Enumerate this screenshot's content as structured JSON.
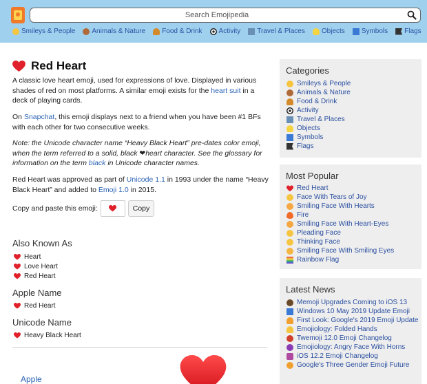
{
  "search": {
    "placeholder": "Search Emojipedia"
  },
  "nav": [
    {
      "label": "Smileys & People",
      "icon": "smiley-icon",
      "color": "#f5c542"
    },
    {
      "label": "Animals & Nature",
      "icon": "bear-icon",
      "color": "#b06a3a"
    },
    {
      "label": "Food & Drink",
      "icon": "burger-icon",
      "color": "#d48a2b"
    },
    {
      "label": "Activity",
      "icon": "soccer-ball-icon",
      "color": "#222222"
    },
    {
      "label": "Travel & Places",
      "icon": "buildings-icon",
      "color": "#6a8fb5"
    },
    {
      "label": "Objects",
      "icon": "lightbulb-icon",
      "color": "#f5d442"
    },
    {
      "label": "Symbols",
      "icon": "symbols-icon",
      "color": "#3a7ad5"
    },
    {
      "label": "Flags",
      "icon": "flag-icon",
      "color": "#333333"
    }
  ],
  "emoji": {
    "title": "Red Heart",
    "desc_pre": "A classic love heart emoji, used for expressions of love. Displayed in various shades of red on most platforms. A similar emoji exists for the ",
    "desc_link": "heart suit",
    "desc_post": " in a deck of playing cards.",
    "p2_pre": "On ",
    "p2_link": "Snapchat",
    "p2_post": ", this emoji displays next to a friend when you have been #1 BFs with each other for two consecutive weeks.",
    "note_pre": "Note: the Unicode character name “Heavy Black Heart” pre-dates color emoji, when the term referred to a solid, black ❤heart character. See the glossary for information on the term ",
    "note_link": "black",
    "note_post": " in Unicode character names.",
    "appr_1": "Red Heart was approved as part of ",
    "appr_link1": "Unicode 1.1",
    "appr_2": " in 1993 under the name “Heavy Black Heart” and added to ",
    "appr_link2": "Emoji 1.0",
    "appr_3": " in 2015.",
    "copy_label": "Copy and paste this emoji:",
    "copy_button": "Copy"
  },
  "also_known_as": {
    "title": "Also Known As",
    "items": [
      "Heart",
      "Love Heart",
      "Red Heart"
    ]
  },
  "apple_name": {
    "title": "Apple Name",
    "value": "Red Heart"
  },
  "unicode_name": {
    "title": "Unicode Name",
    "value": "Heavy Black Heart"
  },
  "vendor_label": "Apple",
  "categories": {
    "title": "Categories",
    "items": [
      {
        "label": "Smileys & People",
        "icon": "smiley-icon",
        "color": "#f5c542"
      },
      {
        "label": "Animals & Nature",
        "icon": "bear-icon",
        "color": "#b06a3a"
      },
      {
        "label": "Food & Drink",
        "icon": "burger-icon",
        "color": "#d48a2b"
      },
      {
        "label": "Activity",
        "icon": "soccer-ball-icon",
        "color": "#222222"
      },
      {
        "label": "Travel & Places",
        "icon": "buildings-icon",
        "color": "#6a8fb5"
      },
      {
        "label": "Objects",
        "icon": "lightbulb-icon",
        "color": "#f5d442"
      },
      {
        "label": "Symbols",
        "icon": "symbols-icon",
        "color": "#3a7ad5"
      },
      {
        "label": "Flags",
        "icon": "flag-icon",
        "color": "#333333"
      }
    ]
  },
  "most_popular": {
    "title": "Most Popular",
    "items": [
      {
        "label": "Red Heart",
        "icon": "red-heart-icon",
        "color": "#e0202a"
      },
      {
        "label": "Face With Tears of Joy",
        "icon": "tears-of-joy-icon",
        "color": "#f5c542"
      },
      {
        "label": "Smiling Face With Hearts",
        "icon": "smiling-hearts-icon",
        "color": "#f5a742"
      },
      {
        "label": "Fire",
        "icon": "fire-icon",
        "color": "#f06a2a"
      },
      {
        "label": "Smiling Face With Heart-Eyes",
        "icon": "heart-eyes-icon",
        "color": "#f5a742"
      },
      {
        "label": "Pleading Face",
        "icon": "pleading-face-icon",
        "color": "#f5c542"
      },
      {
        "label": "Thinking Face",
        "icon": "thinking-face-icon",
        "color": "#f5c542"
      },
      {
        "label": "Smiling Face With Smiling Eyes",
        "icon": "smiling-eyes-icon",
        "color": "#f5b542"
      },
      {
        "label": "Rainbow Flag",
        "icon": "rainbow-flag-icon",
        "color": "#e04aa0"
      }
    ]
  },
  "latest_news": {
    "title": "Latest News",
    "items": [
      {
        "label": "Memoji Upgrades Coming to iOS 13",
        "icon": "memoji-icon",
        "color": "#6a4a2a"
      },
      {
        "label": "Windows 10 May 2019 Update Emoji",
        "icon": "windows-icon",
        "color": "#3a7ad5"
      },
      {
        "label": "First Look: Google's 2019 Emoji Update",
        "icon": "person-icon",
        "color": "#f0a030"
      },
      {
        "label": "Emojiology: Folded Hands",
        "icon": "folded-hands-icon",
        "color": "#f5c542"
      },
      {
        "label": "Twemoji 12.0 Emoji Changelog",
        "icon": "twemoji-icon",
        "color": "#d0402a"
      },
      {
        "label": "Emojiology: Angry Face With Horns",
        "icon": "angry-horns-icon",
        "color": "#8a3ab5"
      },
      {
        "label": "iOS 12.2 Emoji Changelog",
        "icon": "ios-icon",
        "color": "#b04aa0"
      },
      {
        "label": "Google's Three Gender Emoji Future",
        "icon": "gender-icon",
        "color": "#f0a030"
      }
    ]
  }
}
